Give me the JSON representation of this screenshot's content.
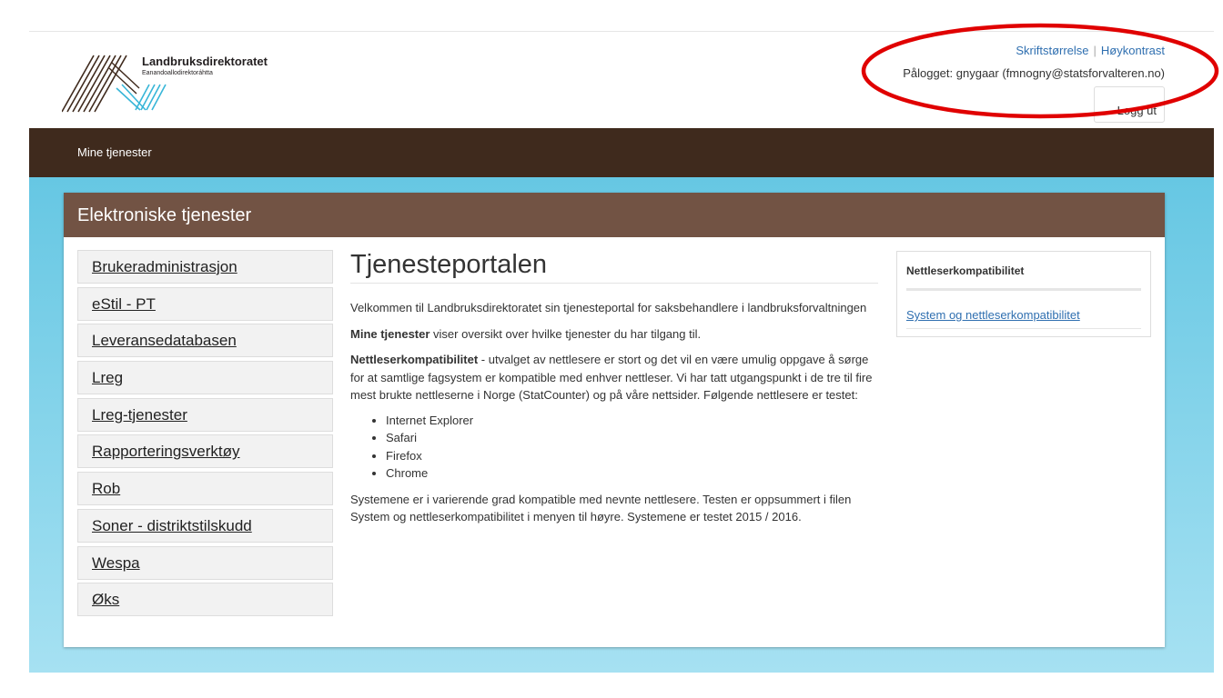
{
  "header": {
    "logo": {
      "title": "Landbruksdirektoratet",
      "subtitle": "Eanandoallodirektoráhtta"
    },
    "util_links": {
      "font_size": "Skriftstørrelse",
      "separator": "|",
      "high_contrast": "Høykontrast"
    },
    "logged_in": "Pålogget: gnygaar (fmnogny@statsforvalteren.no)",
    "logout_label": "Logg ut"
  },
  "nav": {
    "my_services": "Mine tjenester"
  },
  "panel": {
    "title": "Elektroniske tjenester",
    "menu": [
      "Brukeradministrasjon",
      "eStil - PT",
      "Leveransedatabasen",
      "Lreg",
      "Lreg-tjenester",
      "Rapporteringsverktøy",
      "Rob",
      "Soner - distriktstilskudd",
      "Wespa",
      "Øks"
    ],
    "main": {
      "title": "Tjenesteportalen",
      "welcome": "Velkommen til Landbruksdirektoratet sin tjenesteportal for saksbehandlere i landbruksforvaltningen",
      "my_services_bold": "Mine tjenester",
      "my_services_text": " viser oversikt over hvilke tjenester du har tilgang til.",
      "compat_bold": "Nettleserkompatibilitet",
      "compat_text": " - utvalget av nettlesere er stort og det vil en være umulig oppgave å sørge for at samtlige fagsystem er kompatible med enhver nettleser. Vi har tatt utgangspunkt i de tre til fire mest brukte nettleserne i Norge (StatCounter) og på våre nettsider. Følgende nettlesere er testet:",
      "browsers": [
        "Internet Explorer",
        "Safari",
        "Firefox",
        "Chrome"
      ],
      "summary": "Systemene er i varierende grad kompatible med nevnte nettlesere. Testen er oppsummert i filen System og nettleserkompatibilitet i menyen til høyre. Systemene er testet 2015 / 2016."
    },
    "sidebar_box": {
      "title": "Nettleserkompatibilitet",
      "link": "System og nettleserkompatibilitet"
    }
  },
  "colors": {
    "navbar": "#3f2a1d",
    "panel_header": "#725344",
    "link": "#2f6fb0",
    "annotation": "#e00000",
    "background_top": "#66c7e3",
    "background_bottom": "#a6e1f2"
  }
}
